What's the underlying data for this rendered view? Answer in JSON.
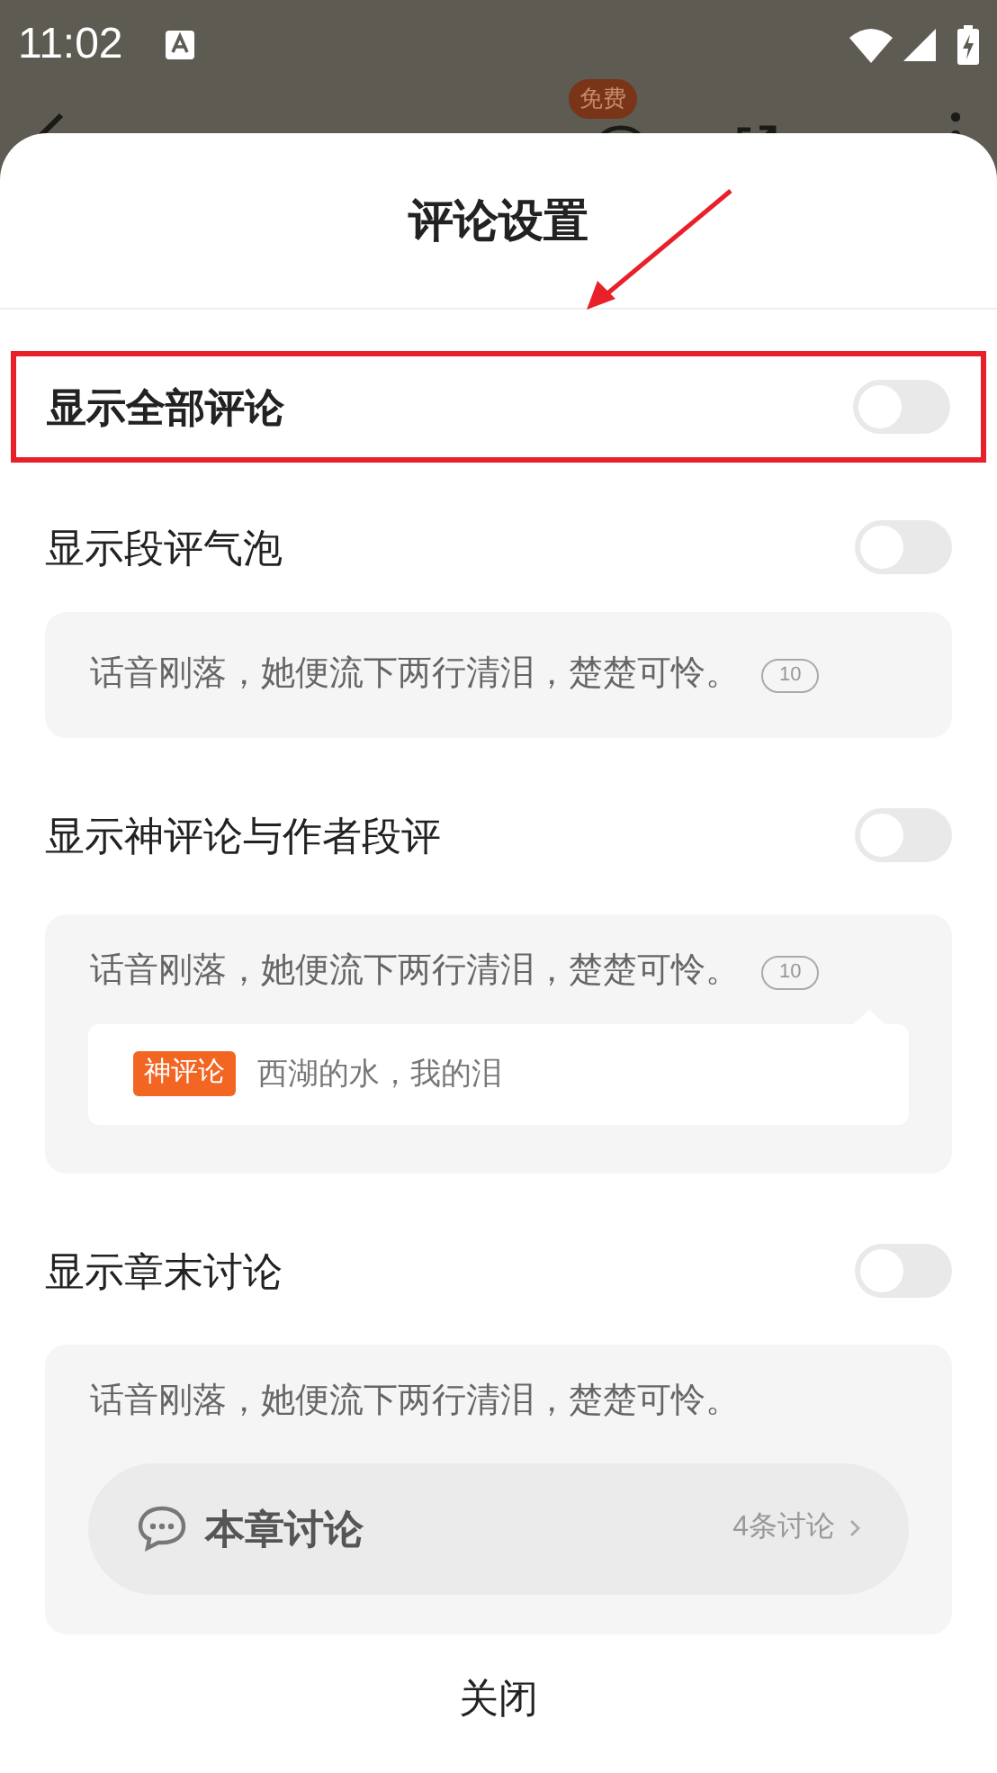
{
  "status_bar": {
    "time": "11:02"
  },
  "toolbar": {
    "items": [
      {
        "kind": "back"
      },
      {
        "kind": "badge",
        "badge": "免费"
      },
      {
        "kind": "chat"
      },
      {
        "kind": "share"
      },
      {
        "kind": "more"
      }
    ]
  },
  "sheet": {
    "title": "评论设置",
    "settings": [
      {
        "label": "显示全部评论",
        "on": false,
        "highlighted": true
      },
      {
        "label": "显示段评气泡",
        "on": false,
        "highlighted": false,
        "preview": {
          "kind": "bubble",
          "text": "话音刚落，她便流下两行清泪，楚楚可怜。",
          "comment_count": "10"
        }
      },
      {
        "label": "显示神评论与作者段评",
        "on": false,
        "highlighted": false,
        "preview": {
          "kind": "god_comment",
          "text": "话音刚落，她便流下两行清泪，楚楚可怜。",
          "comment_count": "10",
          "tag": "神评论",
          "comment": "西湖的水，我的泪"
        }
      },
      {
        "label": "显示章末讨论",
        "on": false,
        "highlighted": false,
        "preview": {
          "kind": "chapter_discussion",
          "text": "话音刚落，她便流下两行清泪，楚楚可怜。",
          "discussion_title": "本章讨论",
          "discussion_count": "4条讨论"
        }
      }
    ],
    "close_button": "关闭"
  }
}
